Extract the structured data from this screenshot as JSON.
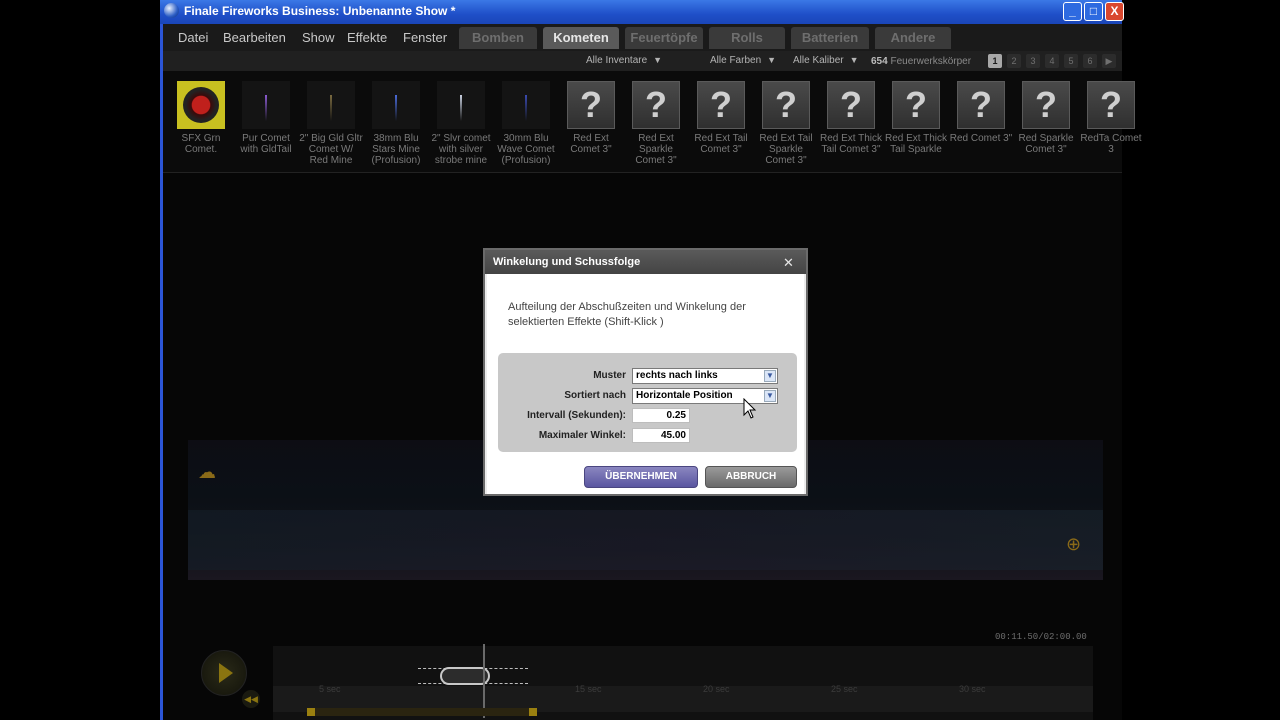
{
  "window": {
    "title": "Finale Fireworks Business: Unbenannte Show *",
    "minimize": "_",
    "maximize": "□",
    "close": "X"
  },
  "menu": [
    "Datei",
    "Bearbeiten",
    "Show",
    "Effekte",
    "Fenster"
  ],
  "category_tabs": [
    {
      "label": "Bomben",
      "active": false
    },
    {
      "label": "Kometen",
      "active": true
    },
    {
      "label": "Feuertöpfe",
      "active": false
    },
    {
      "label": "Rolls",
      "active": false
    },
    {
      "label": "Batterien",
      "active": false
    },
    {
      "label": "Andere",
      "active": false
    }
  ],
  "filters": {
    "inventory": "Alle Inventare",
    "colors": "Alle Farben",
    "calibers": "Alle Kaliber",
    "count_number": "654",
    "count_label": "Feuerwerkskörper",
    "pages": [
      "1",
      "2",
      "3",
      "4",
      "5",
      "6"
    ],
    "next_page": "▶"
  },
  "products": [
    {
      "label": "SFX Grn Comet.",
      "thumb": "logo"
    },
    {
      "label": "Pur Comet with GldTail",
      "thumb": "streak",
      "color": "#8a5ad0"
    },
    {
      "label": "2\" Big Gld Gltr Comet W/ Red Mine",
      "thumb": "streak",
      "color": "#7a6a40"
    },
    {
      "label": "38mm Blu Stars Mine (Profusion)",
      "thumb": "streak",
      "color": "#4a6ad8"
    },
    {
      "label": "2\" Slvr comet with silver strobe mine",
      "thumb": "streak",
      "color": "#c8d0e0"
    },
    {
      "label": "30mm Blu Wave Comet (Profusion)",
      "thumb": "streak",
      "color": "#3a4ab0"
    },
    {
      "label": "Red Ext Comet 3\"",
      "thumb": "unknown"
    },
    {
      "label": "Red Ext Sparkle Comet 3\"",
      "thumb": "unknown"
    },
    {
      "label": "Red Ext Tail Comet 3\"",
      "thumb": "unknown"
    },
    {
      "label": "Red Ext Tail Sparkle Comet 3\"",
      "thumb": "unknown"
    },
    {
      "label": "Red Ext Thick Tail Comet 3\"",
      "thumb": "unknown"
    },
    {
      "label": "Red Ext Thick Tail Sparkle",
      "thumb": "unknown"
    },
    {
      "label": "Red Comet 3\"",
      "thumb": "unknown"
    },
    {
      "label": "Red Sparkle Comet 3\"",
      "thumb": "unknown"
    },
    {
      "label": "RedTa Comet 3",
      "thumb": "unknown"
    }
  ],
  "unknown_glyph": "?",
  "timeline": {
    "timecode": "00:11.50/02:00.00",
    "ticks": [
      "5 sec",
      "15 sec",
      "20 sec",
      "25 sec",
      "30 sec"
    ]
  },
  "dialog": {
    "title": "Winkelung und Schussfolge",
    "close": "✕",
    "description": "Aufteilung der Abschußzeiten und Winkelung der selektierten Effekte (Shift-Klick )",
    "fields": {
      "pattern_label": "Muster",
      "pattern_value": "rechts nach links",
      "sort_label": "Sortiert nach",
      "sort_value": "Horizontale Position",
      "interval_label": "Intervall (Sekunden):",
      "interval_value": "0.25",
      "angle_label": "Maximaler Winkel:",
      "angle_value": "45.00"
    },
    "apply_button": "ÜBERNEHMEN",
    "cancel_button": "ABBRUCH"
  }
}
